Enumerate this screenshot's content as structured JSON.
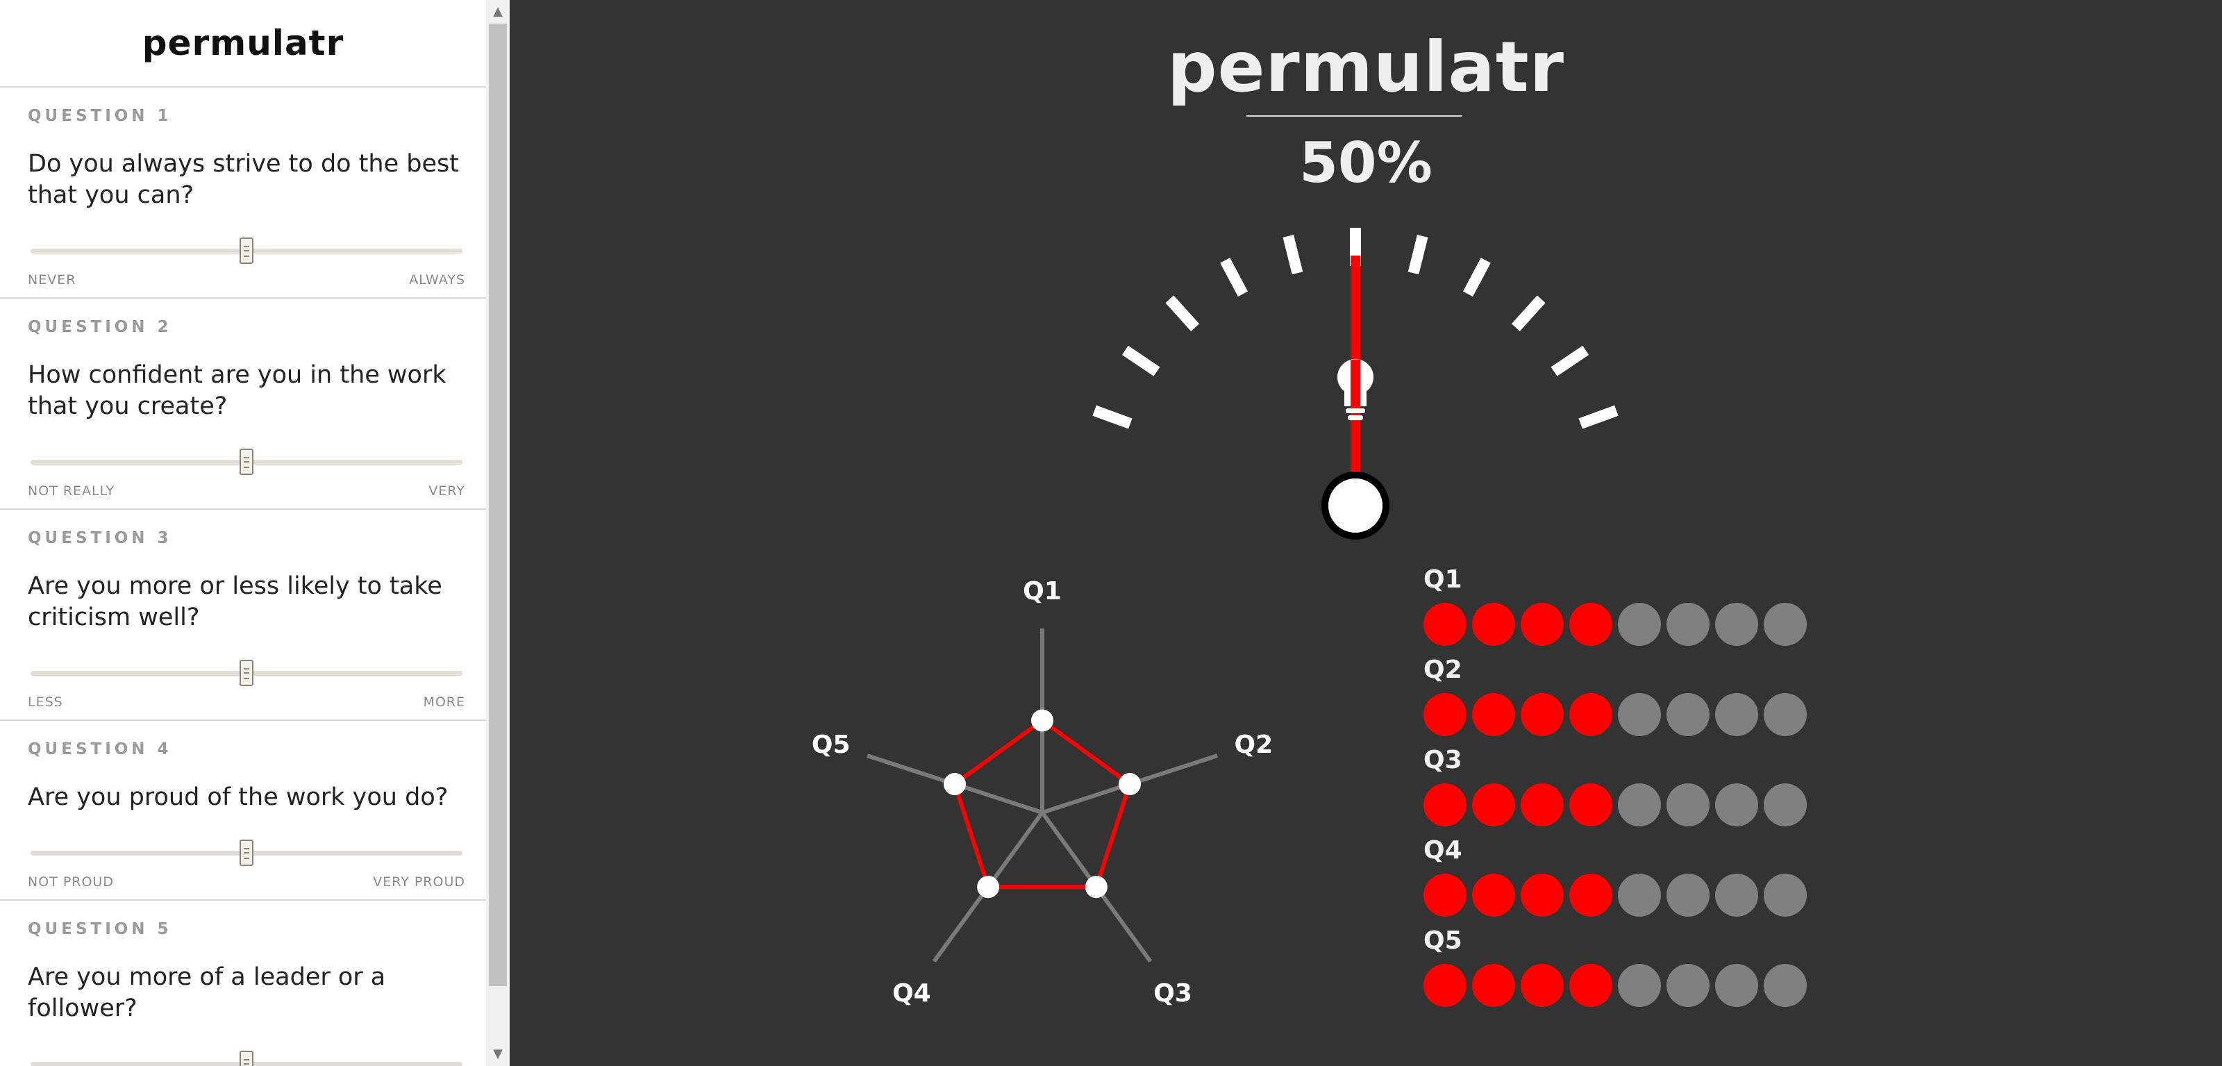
{
  "app": {
    "name": "permulatr"
  },
  "sidebar": {
    "questions": [
      {
        "number": "QUESTION 1",
        "text": "Do you always strive to do the best that you can?",
        "min_label": "NEVER",
        "max_label": "ALWAYS",
        "value": 0.5
      },
      {
        "number": "QUESTION 2",
        "text": "How confident are you in the work that you create?",
        "min_label": "NOT REALLY",
        "max_label": "VERY",
        "value": 0.5
      },
      {
        "number": "QUESTION 3",
        "text": "Are you more or less likely to take criticism well?",
        "min_label": "LESS",
        "max_label": "MORE",
        "value": 0.5
      },
      {
        "number": "QUESTION 4",
        "text": "Are you proud of the work you do?",
        "min_label": "NOT PROUD",
        "max_label": "VERY PROUD",
        "value": 0.5
      },
      {
        "number": "QUESTION 5",
        "text": "Are you more of a leader or a follower?",
        "min_label": "",
        "max_label": "",
        "value": 0.5
      }
    ]
  },
  "main": {
    "title": "permulatr",
    "percent_text": "50%",
    "gauge_value": 0.5,
    "gauge_ticks": 11,
    "gauge_icon": "lightbulb-icon",
    "radar": {
      "labels": [
        "Q1",
        "Q2",
        "Q3",
        "Q4",
        "Q5"
      ],
      "values": [
        0.5,
        0.5,
        0.5,
        0.5,
        0.5
      ]
    },
    "dot_rows": [
      {
        "label": "Q1",
        "filled": 4,
        "total": 8
      },
      {
        "label": "Q2",
        "filled": 4,
        "total": 8
      },
      {
        "label": "Q3",
        "filled": 4,
        "total": 8
      },
      {
        "label": "Q4",
        "filled": 4,
        "total": 8
      },
      {
        "label": "Q5",
        "filled": 4,
        "total": 8
      }
    ]
  },
  "colors": {
    "accent": "#ff0000",
    "background": "#333333",
    "inactive": "#808080",
    "tick": "#ffffff",
    "radar_spoke": "#7a7a7a"
  },
  "scrollbar": {
    "up_icon": "scroll-up-arrow-icon",
    "down_icon": "scroll-down-arrow-icon"
  }
}
